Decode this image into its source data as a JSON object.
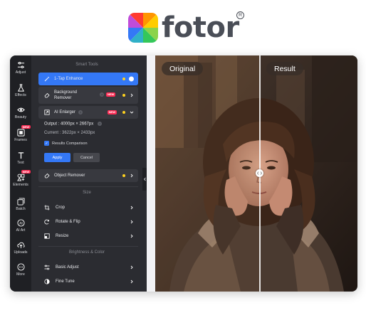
{
  "brand": {
    "name": "fotor",
    "registered_mark": "R"
  },
  "rail": {
    "items": [
      {
        "label": "Adjust",
        "icon": "sliders-icon",
        "is_new": false
      },
      {
        "label": "Effects",
        "icon": "flask-icon",
        "is_new": false
      },
      {
        "label": "Beauty",
        "icon": "eye-icon",
        "is_new": false
      },
      {
        "label": "Frames",
        "icon": "frame-icon",
        "is_new": true
      },
      {
        "label": "Text",
        "icon": "text-icon",
        "is_new": false
      },
      {
        "label": "Elements",
        "icon": "shapes-icon",
        "is_new": true
      },
      {
        "label": "Batch",
        "icon": "batch-icon",
        "is_new": false
      },
      {
        "label": "AI Art",
        "icon": "ai-art-icon",
        "is_new": false
      },
      {
        "label": "Uploads",
        "icon": "cloud-upload-icon",
        "is_new": false
      },
      {
        "label": "More",
        "icon": "more-icon",
        "is_new": false
      }
    ],
    "new_badge": "NEW"
  },
  "panel": {
    "smart_tools_title": "Smart Tools",
    "one_tap": "1-Tap Enhance",
    "bg_remover_line1": "Background",
    "bg_remover_line2": "Remover",
    "ai_enlarger": "AI Enlarger",
    "new_tag": "NEW",
    "output": "Output : 4000px × 2667px",
    "current": "Current : 3622px × 2433px",
    "results_comparison": "Results Comparison",
    "apply": "Apply",
    "cancel": "Cancel",
    "object_remover": "Object Remover",
    "size_title": "Size",
    "crop": "Crop",
    "rotate_flip": "Rotate & Flip",
    "resize": "Resize",
    "brightness_title": "Brightness & Color",
    "basic_adjust": "Basic Adjust",
    "fine_tune": "Fine Tune"
  },
  "canvas": {
    "label_left": "Original",
    "label_right": "Result"
  },
  "colors": {
    "accent": "#3478f6",
    "new_badge": "#ff2d55",
    "indicator": "#ffd21f",
    "panel_bg": "#2b2c31",
    "rail_bg": "#1f2024"
  }
}
